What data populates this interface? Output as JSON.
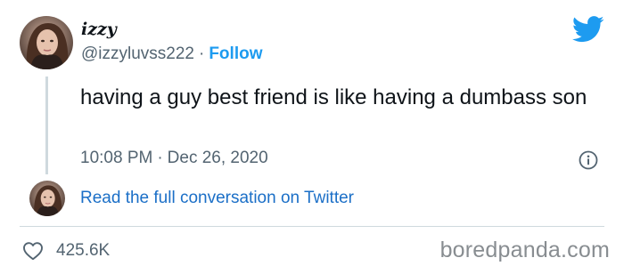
{
  "tweet": {
    "author": {
      "display_name": "izzy",
      "handle": "@izzyluvss222",
      "separator": "·",
      "follow_label": "Follow"
    },
    "text": "having a guy best friend is like having a dumbass son",
    "time": "10:08 PM",
    "time_separator": "·",
    "date": "Dec 26, 2020",
    "read_conversation_label": "Read the full conversation on Twitter",
    "likes": "425.6K"
  },
  "watermark": "boredpanda.com",
  "icons": {
    "brand": "twitter-bird-icon",
    "info": "info-icon",
    "like": "heart-icon"
  },
  "colors": {
    "accent": "#1d9bf0",
    "link": "#1b6fc7",
    "muted_text": "#536471",
    "text": "#0f1419"
  }
}
